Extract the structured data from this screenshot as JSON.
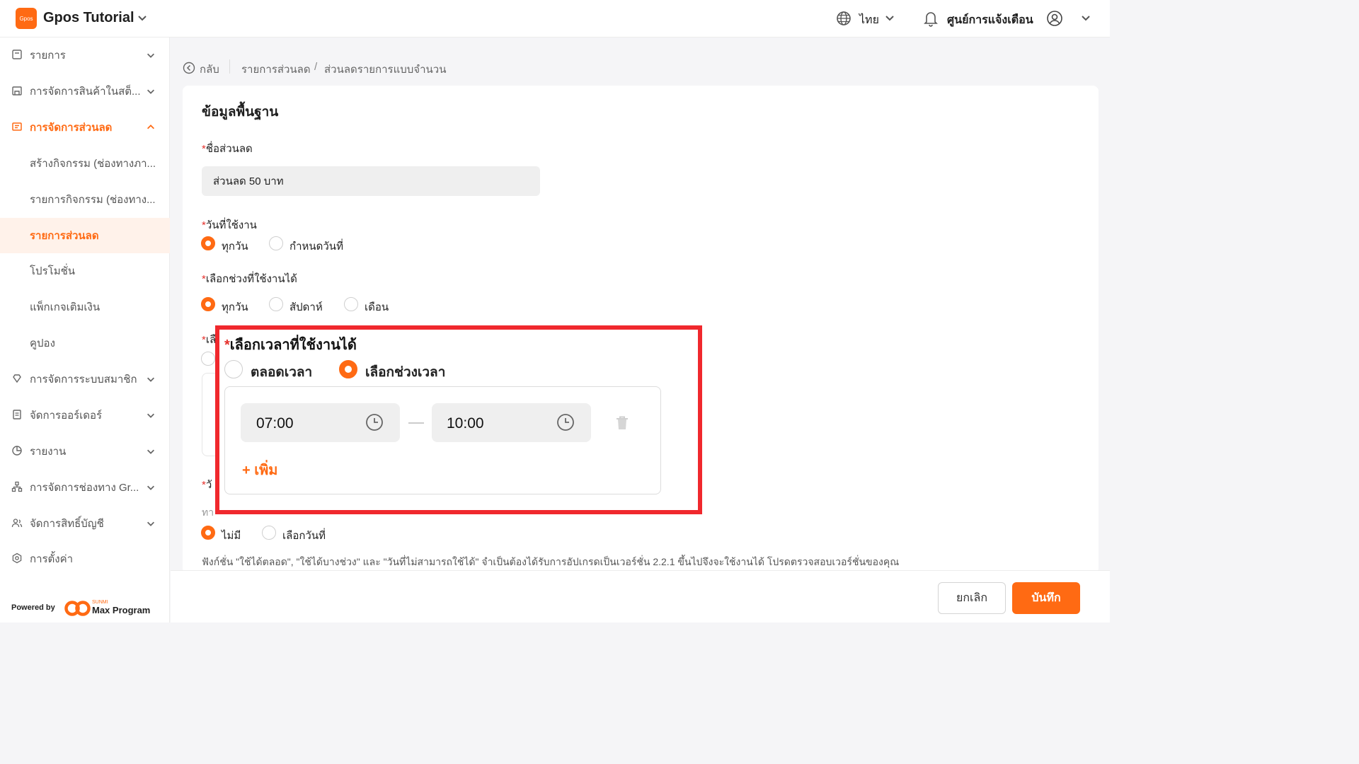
{
  "header": {
    "logo_text": "Gpos",
    "app_title": "Gpos Tutorial",
    "language": "ไทย",
    "notifications_label": "ศูนย์การแจ้งเตือน"
  },
  "sidebar": {
    "items": [
      {
        "label": "รายการ",
        "icon": "list-icon"
      },
      {
        "label": "การจัดการสินค้าในสต็...",
        "icon": "store-icon"
      },
      {
        "label": "การจัดการส่วนลด",
        "icon": "ticket-icon"
      },
      {
        "label": "สร้างกิจกรรม (ช่องทางภา..."
      },
      {
        "label": "รายการกิจกรรม (ช่องทาง..."
      },
      {
        "label": "รายการส่วนลด"
      },
      {
        "label": "โปรโมชั่น"
      },
      {
        "label": "แพ็กเกจเติมเงิน"
      },
      {
        "label": "คูปอง"
      },
      {
        "label": "การจัดการระบบสมาชิก",
        "icon": "gem-icon"
      },
      {
        "label": "จัดการออร์เดอร์",
        "icon": "order-icon"
      },
      {
        "label": "รายงาน",
        "icon": "pie-icon"
      },
      {
        "label": "การจัดการช่องทาง Gr...",
        "icon": "channel-icon"
      },
      {
        "label": "จัดการสิทธิ์บัญชี",
        "icon": "users-icon"
      },
      {
        "label": "การตั้งค่า",
        "icon": "settings-icon"
      }
    ],
    "powered_by": "Powered by",
    "brand_small": "SUNMI",
    "brand_name": "Max Program"
  },
  "breadcrumb": {
    "back": "กลับ",
    "item1": "รายการส่วนลด",
    "separator": "/",
    "item2": "ส่วนลดรายการแบบจำนวน"
  },
  "form": {
    "section_title": "ข้อมูลพื้นฐาน",
    "required_mark": "*",
    "discount_name_label": "ชื่อส่วนลด",
    "discount_name_value": "ส่วนลด 50 บาท",
    "usage_day_label": "วันที่ใช้งาน",
    "usage_day_options": [
      "ทุกวัน",
      "กำหนดวันที่"
    ],
    "period_label": "เลือกช่วงที่ใช้งานได้",
    "period_options": [
      "ทุกวัน",
      "สัปดาห์",
      "เดือน"
    ],
    "hidden_label_fragment": "เลื",
    "hidden_label_fragment2": "วั",
    "hidden_hint": "ทา",
    "exclude_options": [
      "ไม่มี",
      "เลือกวันที่"
    ],
    "time_label": "เลือกเวลาที่ใช้งานได้",
    "time_options": [
      "ตลอดเวลา",
      "เลือกช่วงเวลา"
    ],
    "time_start": "07:00",
    "time_end": "10:00",
    "add_label": "+ เพิ่ม",
    "note": "ฟังก์ชั่น \"ใช้ได้ตลอด\", \"ใช้ได้บางช่วง\" และ \"วันที่ไม่สามารถใช้ได้\" จำเป็นต้องได้รับการอัปเกรดเป็นเวอร์ชั่น 2.2.1 ขึ้นไปจึงจะใช้งานได้ โปรดตรวจสอบเวอร์ชั่นของคุณ"
  },
  "footer": {
    "cancel": "ยกเลิก",
    "save": "บันทึก"
  },
  "colors": {
    "accent": "#ff6a13",
    "highlight": "#f0282d",
    "required": "#e5312c"
  }
}
